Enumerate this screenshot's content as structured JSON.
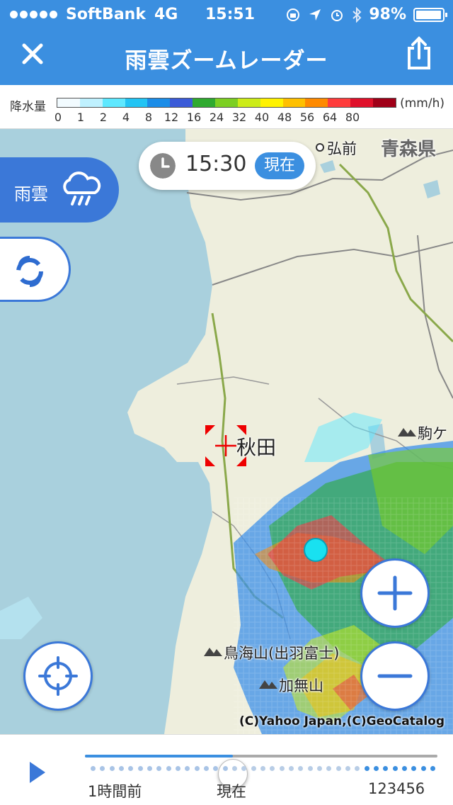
{
  "status_bar": {
    "carrier": "SoftBank",
    "network": "4G",
    "time": "15:51",
    "battery": "98%"
  },
  "nav": {
    "title": "雨雲ズームレーダー",
    "close_icon": "close-icon",
    "share_icon": "share-icon"
  },
  "legend": {
    "label": "降水量",
    "unit": "(mm/h)",
    "ticks": [
      "0",
      "1",
      "2",
      "4",
      "8",
      "12",
      "16",
      "24",
      "32",
      "40",
      "48",
      "56",
      "64",
      "80"
    ],
    "colors": [
      "#f2fbff",
      "#bff1ff",
      "#5ee8ff",
      "#22c4f4",
      "#1b8de8",
      "#3b5bd8",
      "#2faa2f",
      "#7ccf22",
      "#ccec18",
      "#fff200",
      "#ffc000",
      "#ff8a00",
      "#ff3c3c",
      "#e0102a",
      "#a00018"
    ]
  },
  "time_pill": {
    "time": "15:30",
    "badge": "現在"
  },
  "layers": {
    "rain_label": "雨雲",
    "rain_icon": "rain-cloud-icon",
    "typhoon_icon": "typhoon-icon"
  },
  "map_labels": {
    "hirosaki": "弘前",
    "aomori_pref": "青森県",
    "akita": "秋田",
    "komagatake": "駒ケ",
    "chokaisan": "鳥海山(出羽富士)",
    "kanasuyama": "加無山"
  },
  "controls": {
    "locate_icon": "locate-icon",
    "zoom_in_icon": "plus-icon",
    "zoom_out_icon": "minus-icon",
    "play_icon": "play-icon"
  },
  "copyright": "(C)Yahoo Japan,(C)GeoCatalog",
  "timeline": {
    "start_label": "1時間前",
    "now_label": "現在",
    "end_label": "123456",
    "position_fraction": 0.42
  }
}
